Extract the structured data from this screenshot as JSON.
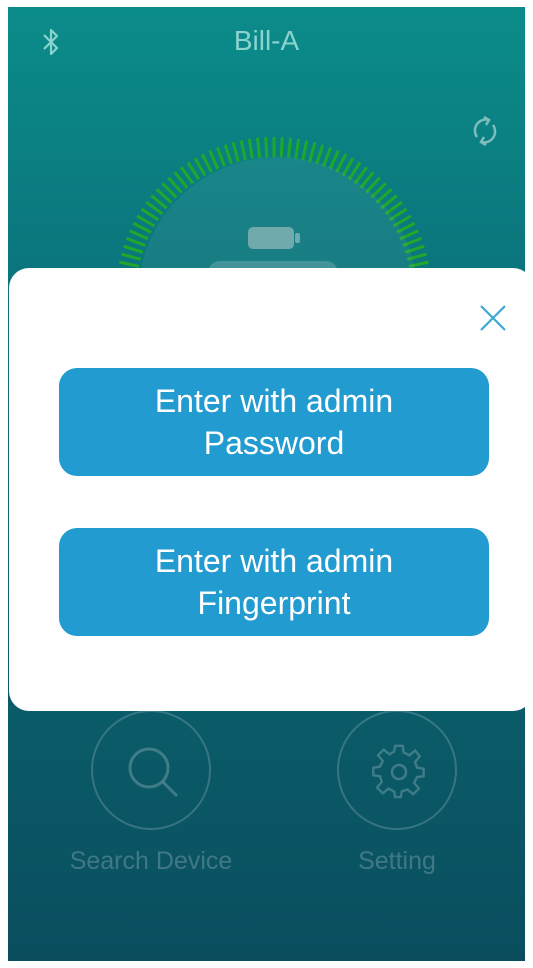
{
  "header": {
    "title": "Bill-A",
    "left_icon": "bluetooth-icon",
    "right_icon": "refresh-icon"
  },
  "dashboard": {
    "gauge_icon": "battery-icon",
    "gauge_color": "#1fa82c"
  },
  "bottom_nav": {
    "search_label": "Search Device",
    "search_icon": "search-icon",
    "setting_label": "Setting",
    "setting_icon": "gear-icon"
  },
  "dialog": {
    "close_icon": "close-icon",
    "password_button": {
      "line1": "Enter with admin",
      "line2": "Password"
    },
    "fingerprint_button": {
      "line1": "Enter with admin",
      "line2": "Fingerprint"
    },
    "button_color": "#229bd0",
    "close_color": "#3ba8d6"
  }
}
